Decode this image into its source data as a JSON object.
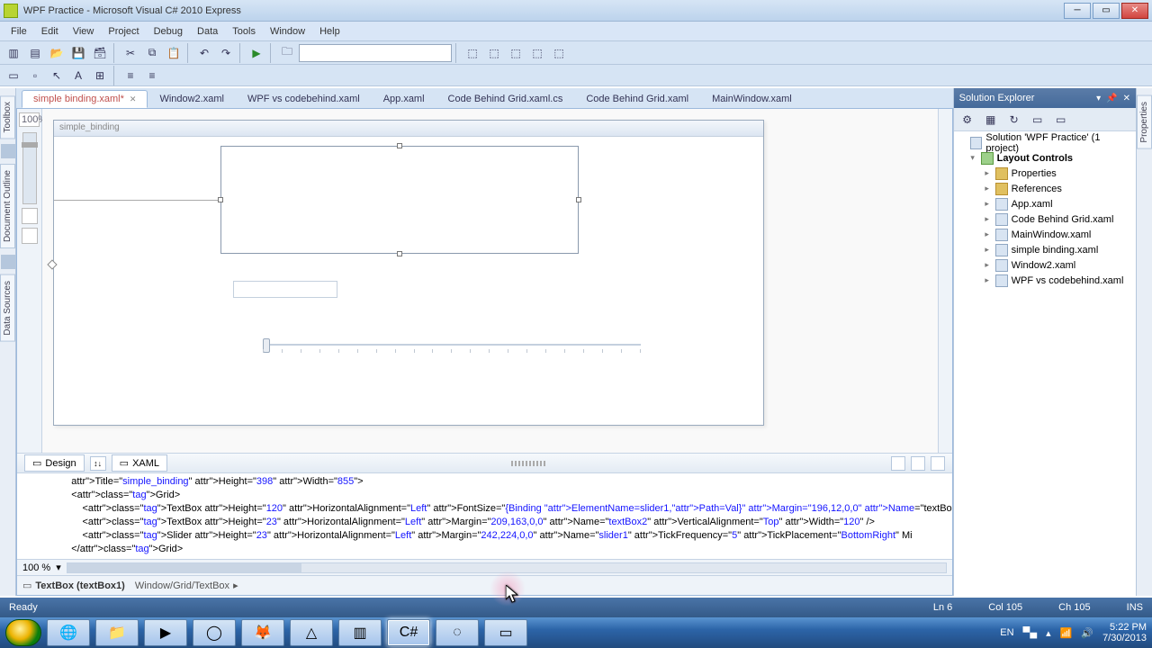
{
  "window": {
    "title": "WPF Practice - Microsoft Visual C# 2010 Express"
  },
  "menu": [
    "File",
    "Edit",
    "View",
    "Project",
    "Debug",
    "Data",
    "Tools",
    "Window",
    "Help"
  ],
  "doctabs": [
    {
      "label": "simple binding.xaml*",
      "active": true
    },
    {
      "label": "Window2.xaml"
    },
    {
      "label": "WPF vs codebehind.xaml"
    },
    {
      "label": "App.xaml"
    },
    {
      "label": "Code Behind Grid.xaml.cs"
    },
    {
      "label": "Code Behind Grid.xaml"
    },
    {
      "label": "MainWindow.xaml"
    }
  ],
  "designer": {
    "zoom": "100%",
    "windowTitle": "simple_binding",
    "bottom_zoom": "100 %"
  },
  "split": {
    "design": "Design",
    "xaml": "XAML"
  },
  "xaml_lines": [
    {
      "indent": 2,
      "raw": "    Title=\"simple_binding\" Height=\"398\" Width=\"855\">"
    },
    {
      "indent": 2,
      "raw": "    <Grid>"
    },
    {
      "indent": 3,
      "raw": "        <TextBox Height=\"120\" HorizontalAlignment=\"Left\" FontSize=\"{Binding ElementName=slider1,Path=Val}\" Margin=\"196,12,0,0\" Name=\"textBo",
      "hl": "{Binding ElementName=slider1,Path=Val}"
    },
    {
      "indent": 3,
      "raw": "        <TextBox Height=\"23\" HorizontalAlignment=\"Left\" Margin=\"209,163,0,0\" Name=\"textBox2\" VerticalAlignment=\"Top\" Width=\"120\" />"
    },
    {
      "indent": 3,
      "raw": "        <Slider Height=\"23\" HorizontalAlignment=\"Left\" Margin=\"242,224,0,0\" Name=\"slider1\" TickFrequency=\"5\" TickPlacement=\"BottomRight\" Mi"
    },
    {
      "indent": 2,
      "raw": "    </Grid>"
    }
  ],
  "breadcrumb": {
    "element": "TextBox (textBox1)",
    "path": "Window/Grid/TextBox"
  },
  "solution": {
    "title": "Solution Explorer",
    "root": "Solution 'WPF Practice' (1 project)",
    "project": "Layout Controls",
    "items": [
      "Properties",
      "References",
      "App.xaml",
      "Code Behind Grid.xaml",
      "MainWindow.xaml",
      "simple binding.xaml",
      "Window2.xaml",
      "WPF vs codebehind.xaml"
    ]
  },
  "leftrail": [
    "Toolbox",
    "Document Outline",
    "Data Sources"
  ],
  "rightrail": [
    "Properties"
  ],
  "status": {
    "ready": "Ready",
    "ln": "Ln 6",
    "col": "Col 105",
    "ch": "Ch 105",
    "ins": "INS"
  },
  "tray": {
    "lang": "EN",
    "time": "5:22 PM",
    "date": "7/30/2013"
  }
}
